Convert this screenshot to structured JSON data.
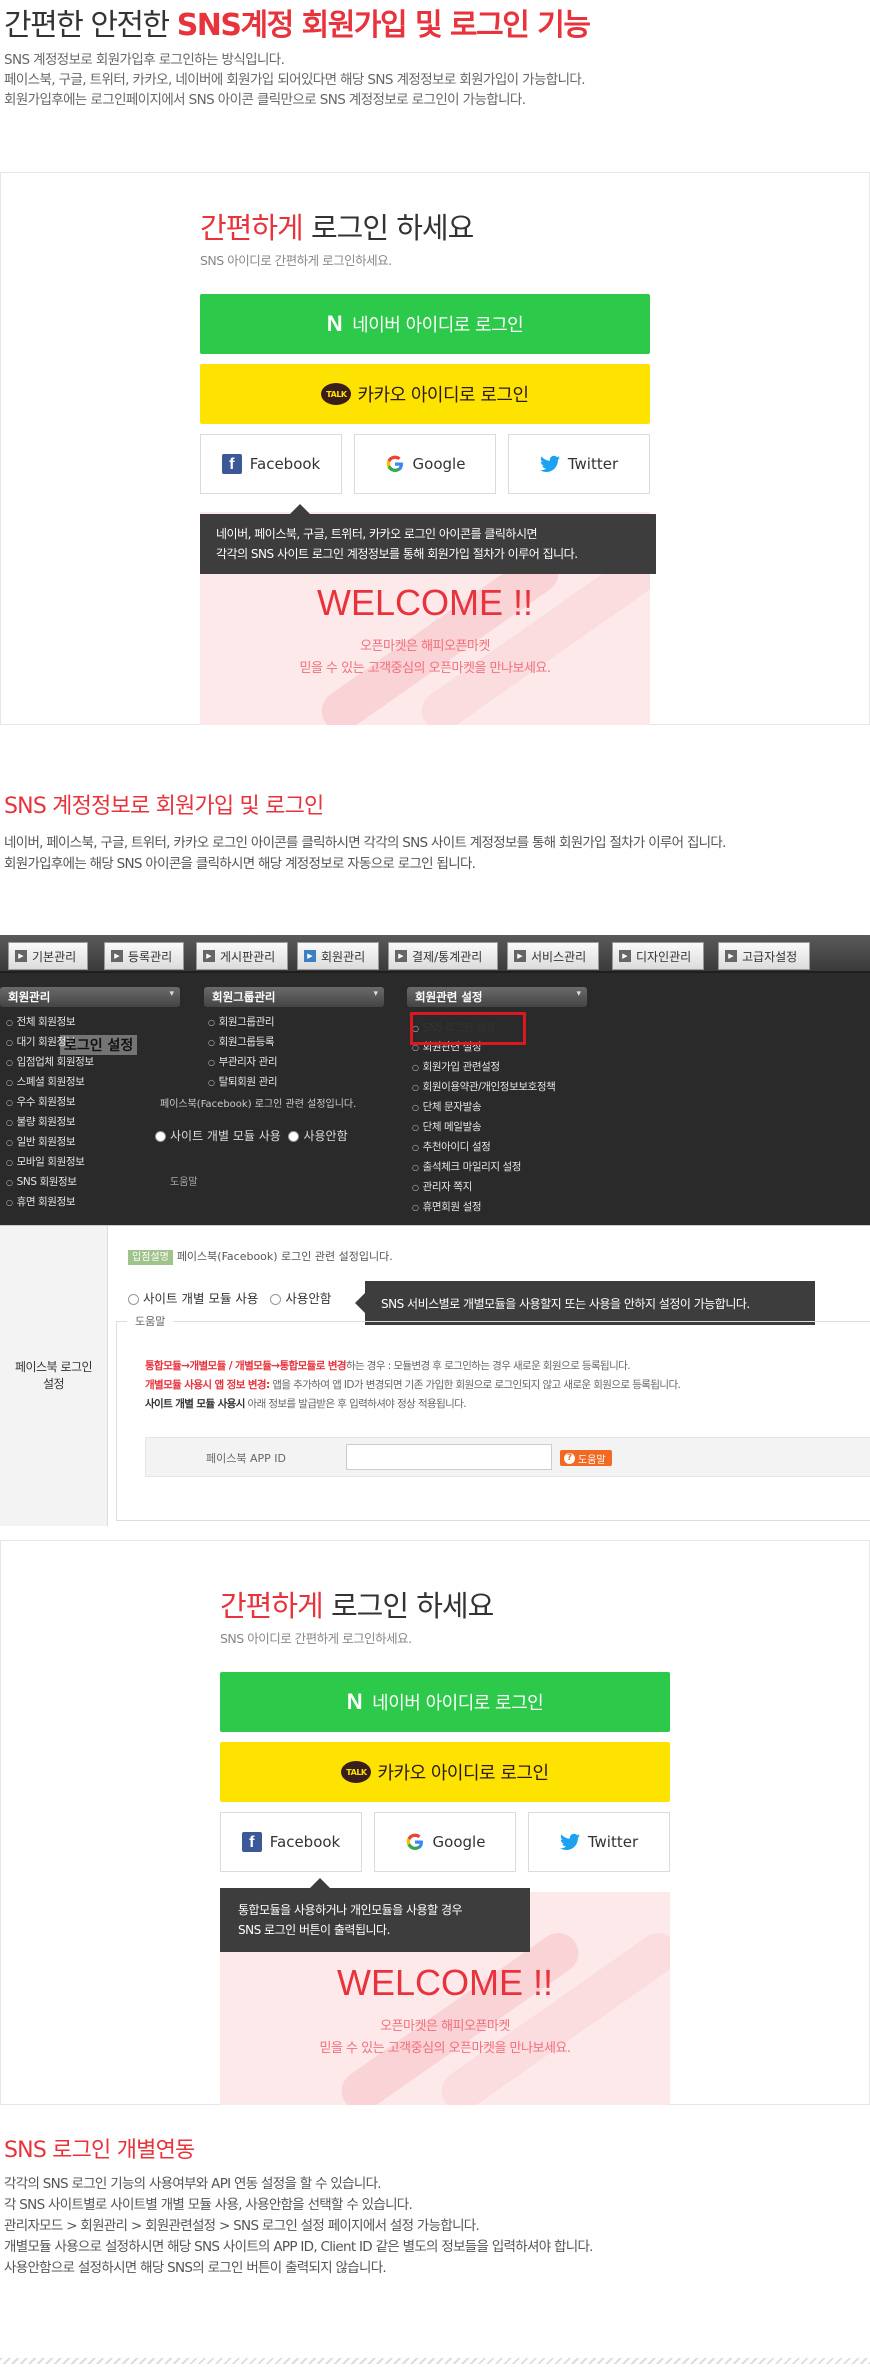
{
  "header": {
    "title_plain": "간편한 안전한 ",
    "title_accent": "SNS계정 회원가입 및 로그인 기능",
    "intro_lines": [
      "SNS 계정정보로 회원가입후 로그인하는 방식입니다.",
      "페이스북, 구글, 트위터, 카카오, 네이버에 회원가입 되어있다면 해당 SNS 계정정보로 회원가입이 가능합니다.",
      "회원가입후에는 로그인페이지에서 SNS 아이콘 클릭만으로 SNS 계정정보로 로그인이 가능합니다."
    ]
  },
  "login_demo_1": {
    "title_accent": "간편하게",
    "title_plain": " 로그인 하세요",
    "subtitle": "SNS 아이디로 간편하게 로그인하세요.",
    "naver_label": "네이버 아이디로 로그인",
    "naver_logo": "N",
    "kakao_label": "카카오 아이디로 로그인",
    "kakao_logo": "TALK",
    "facebook_label": "Facebook",
    "google_label": "Google",
    "twitter_label": "Twitter",
    "tooltip_lines": [
      "네이버, 페이스북, 구글, 트위터, 카카오 로그인 아이콘를 클릭하시면",
      "각각의 SNS 사이트 로그인 계정정보를 통해 회원가입 절차가 이루어 집니다."
    ],
    "welcome": "WELCOME !!",
    "welcome_lines": [
      "오픈마켓은 해피오픈마켓",
      "믿을 수 있는 고객중심의 오픈마켓을 만나보세요."
    ]
  },
  "section_signup": {
    "title": "SNS 계정정보로 회원가입 및 로그인",
    "lines": [
      "네이버, 페이스북, 구글, 트위터, 카카오 로그인 아이콘를 클릭하시면 각각의 SNS 사이트 계정정보를 통해 회원가입 절차가 이루어 집니다.",
      "회원가입후에는 해당 SNS 아이콘을 클릭하시면 해당 계정정보로 자동으로 로그인 됩니다."
    ]
  },
  "admin": {
    "tabs": [
      "기본관리",
      "등록관리",
      "게시판관리",
      "회원관리",
      "결제/통계관리",
      "서비스관리",
      "디자인관리",
      "고급자설정"
    ],
    "columns": [
      {
        "title": "회원관리",
        "items": [
          "전체 회원정보",
          "대기 회원정보",
          "입점업체 회원정보",
          "스폐셜 회원정보",
          "우수 회원정보",
          "불량 회원정보",
          "일반 회원정보",
          "모바일 회원정보",
          "SNS 회원정보",
          "휴면 회원정보"
        ]
      },
      {
        "title": "회원그룹관리",
        "items": [
          "회원그룹관리",
          "회원그룹등록",
          "부관리자 관리",
          "탈퇴회원 관리"
        ]
      },
      {
        "title": "회원관련 설정",
        "items": [
          "SNS 로그인 설정",
          "회원관련 설정",
          "회원가입 관련설정",
          "회원이용약관/개인정보보호정책",
          "단체 문자발송",
          "단체 메일발송",
          "추천아이디 설정",
          "출석체크 마일리지 설정",
          "관리자 쪽지",
          "휴면회원 설정"
        ]
      }
    ],
    "overlay_title": "로그인 설정",
    "overlay_note": "페이스북(Facebook) 로그인 관련 설정입니다.",
    "overlay_radio_1": "사이트 개별 모듈 사용",
    "overlay_radio_2": "사용안함",
    "overlay_help": "도움말"
  },
  "settings_form": {
    "label_line1": "페이스북 로그인",
    "label_line2": "설정",
    "badge": "입점설명",
    "note": "페이스북(Facebook) 로그인 관련 설정입니다.",
    "radio_1": "사이트 개별 모듈 사용",
    "radio_2": "사용안함",
    "tooltip": "SNS 서비스별로 개별모듈을 사용할지 또는 사용을 안하지 설정이 가능합니다.",
    "help_legend": "도움말",
    "help_1_red": "통합모듈→개별모듈 / 개별모듈→통합모듈로 변경",
    "help_1_rest": "하는 경우 : 모듈변경 후 로그인하는 경우 새로운 회원으로 등록됩니다.",
    "help_2_red": "개별모듈 사용시 앱 정보 변경:",
    "help_2_rest": " 앱을 추가하여 앱 ID가 변경되면 기존 가입한 회원으로 로그인되지 않고 새로운 회원으로 등록됩니다.",
    "help_3_bold": "사이트 개별 모듈 사용시",
    "help_3_rest": " 아래 정보를 발급받은 후 입력하셔야 정상 적용됩니다.",
    "app_id_label": "페이스북 APP ID",
    "help_button": "도움말"
  },
  "login_demo_2": {
    "title_accent": "간편하게",
    "title_plain": " 로그인 하세요",
    "subtitle": "SNS 아이디로 간편하게 로그인하세요.",
    "naver_label": "네이버 아이디로 로그인",
    "naver_logo": "N",
    "kakao_label": "카카오 아이디로 로그인",
    "kakao_logo": "TALK",
    "facebook_label": "Facebook",
    "google_label": "Google",
    "twitter_label": "Twitter",
    "tooltip_lines": [
      "통합모듈을 사용하거나 개인모듈을 사용할 경우",
      "SNS 로그인 버튼이 출력됩니다."
    ],
    "welcome": "WELCOME !!",
    "welcome_lines": [
      "오픈마켓은 해피오픈마켓",
      "믿을 수 있는 고객중심의 오픈마켓을 만나보세요."
    ]
  },
  "section_individual": {
    "title": "SNS 로그인 개별연동",
    "lines": [
      "각각의 SNS 로그인 기능의 사용여부와 API 연동 설정을 할 수 있습니다.",
      "각 SNS 사이트별로 사이트별 개별 모듈 사용, 사용안함을 선택할 수 있습니다.",
      "관리자모드 > 회원관리 > 회원관련설정 > SNS 로그인 설정 페이지에서 설정 가능합니다.",
      "개별모듈 사용으로 설정하시면 해당 SNS 사이트의 APP ID, Client ID 같은 별도의 정보들을 입력하셔야 합니다.",
      "사용안함으로 설정하시면 해당 SNS의 로그인 버튼이 출력되지 않습니다."
    ]
  },
  "colors": {
    "accent": "#e8323c",
    "naver": "#2cc94a",
    "kakao": "#ffe300",
    "facebook": "#3b5998",
    "twitter": "#1da1f2"
  }
}
